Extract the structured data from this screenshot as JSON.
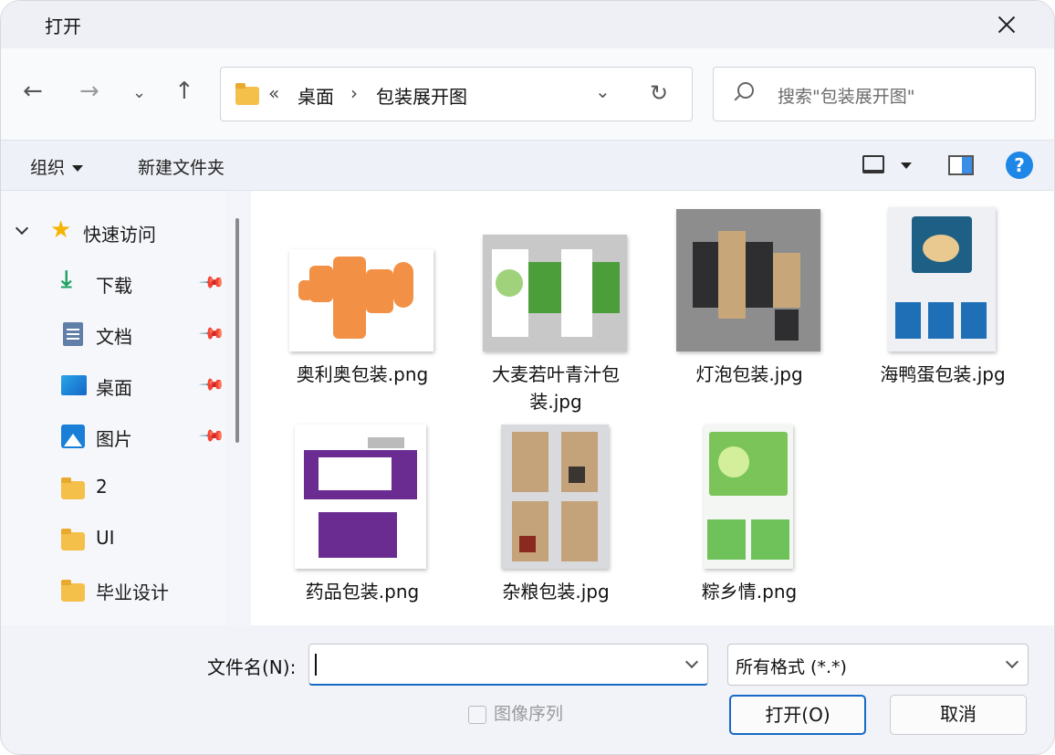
{
  "window": {
    "title": "打开"
  },
  "nav": {
    "back_icon": "back-arrow-icon",
    "forward_icon": "forward-arrow-icon",
    "recent_icon": "chevron-down-icon",
    "up_icon": "up-arrow-icon",
    "breadcrumb_prefix": "«",
    "breadcrumbs": [
      "桌面",
      "包装展开图"
    ],
    "breadcrumb_sep": "›",
    "search_placeholder": "搜索\"包装展开图\""
  },
  "toolbar": {
    "organize_label": "组织",
    "new_folder_label": "新建文件夹",
    "help_label": "?"
  },
  "sidebar": {
    "section_label": "快速访问",
    "items": [
      {
        "label": "下载",
        "icon": "download-icon",
        "pinned": true
      },
      {
        "label": "文档",
        "icon": "document-icon",
        "pinned": true
      },
      {
        "label": "桌面",
        "icon": "desktop-icon",
        "pinned": true
      },
      {
        "label": "图片",
        "icon": "pictures-icon",
        "pinned": true
      },
      {
        "label": "2",
        "icon": "folder-icon",
        "pinned": false
      },
      {
        "label": "UI",
        "icon": "folder-icon",
        "pinned": false
      },
      {
        "label": "毕业设计",
        "icon": "folder-icon",
        "pinned": false
      }
    ]
  },
  "files": [
    {
      "name": "奥利奥包装.png"
    },
    {
      "name": "大麦若叶青汁包装.jpg",
      "line1": "大麦若叶青汁包",
      "line2": "装.jpg"
    },
    {
      "name": "灯泡包装.jpg"
    },
    {
      "name": "海鸭蛋包装.jpg"
    },
    {
      "name": "药品包装.png"
    },
    {
      "name": "杂粮包装.jpg"
    },
    {
      "name": "粽乡情.png"
    }
  ],
  "footer": {
    "filename_label": "文件名(N):",
    "filename_value": "",
    "filetype_value": "所有格式 (*.*)",
    "image_sequence_label": "图像序列",
    "image_sequence_checked": false,
    "open_label": "打开(O)",
    "cancel_label": "取消"
  },
  "colors": {
    "accent": "#1769c4",
    "folder": "#f4c04a",
    "star": "#f5b400"
  }
}
